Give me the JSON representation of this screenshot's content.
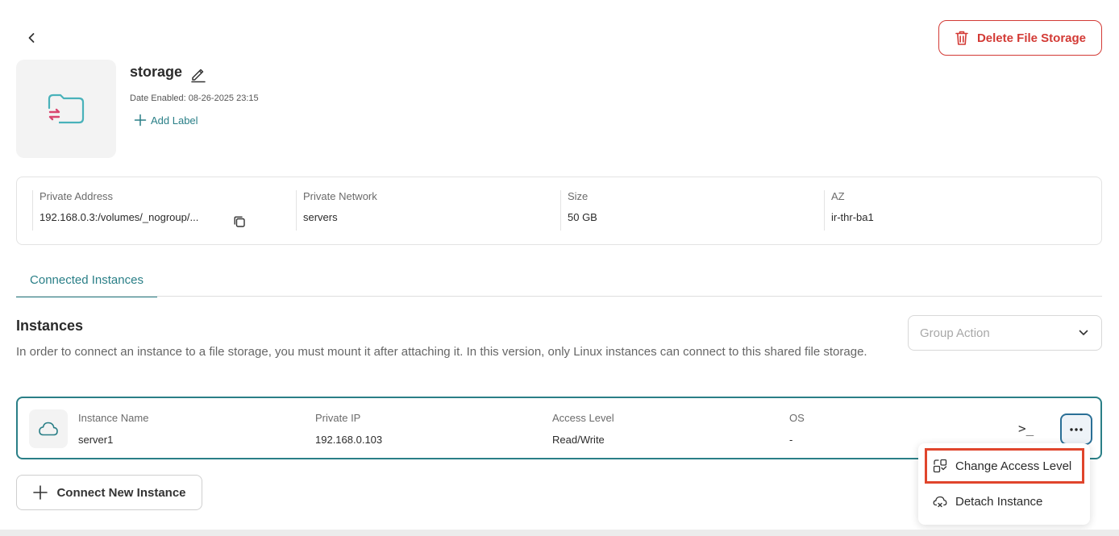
{
  "header": {
    "back_icon": "chevron-left-icon",
    "delete_button_label": "Delete File Storage",
    "delete_icon": "trash-icon",
    "accent_color": "#d33a35"
  },
  "storage": {
    "name": "storage",
    "date_enabled": "Date Enabled: 08-26-2025   23:15",
    "add_label": "Add Label",
    "thumbnail_icon": "folder-transfer-icon"
  },
  "info": {
    "private_address": {
      "label": "Private Address",
      "value": "192.168.0.3:/volumes/_nogroup/..."
    },
    "private_network": {
      "label": "Private Network",
      "value": "servers"
    },
    "size": {
      "label": "Size",
      "value": "50 GB"
    },
    "az": {
      "label": "AZ",
      "value": "ir-thr-ba1"
    }
  },
  "tabs": [
    {
      "label": "Connected Instances",
      "active": true
    }
  ],
  "instances_section": {
    "title": "Instances",
    "description": "In order to connect an instance to a file storage, you must mount it after attaching it. In this version, only Linux instances can connect to this shared file storage.",
    "group_action_placeholder": "Group Action"
  },
  "instances": [
    {
      "name_label": "Instance Name",
      "name": "server1",
      "ip_label": "Private IP",
      "ip": "192.168.0.103",
      "access_label": "Access Level",
      "access": "Read/Write",
      "os_label": "OS",
      "os": "-",
      "terminal_symbol": ">_",
      "icon": "cloud-icon"
    }
  ],
  "context_menu": {
    "items": [
      {
        "label": "Change Access Level",
        "icon": "access-level-icon",
        "highlighted": true
      },
      {
        "label": "Detach Instance",
        "icon": "cloud-detach-icon",
        "highlighted": false
      }
    ]
  },
  "connect_button_label": "Connect New Instance",
  "theme": {
    "primary": "#2a7f87",
    "danger": "#d33a35",
    "highlight_border": "#e0452c"
  }
}
